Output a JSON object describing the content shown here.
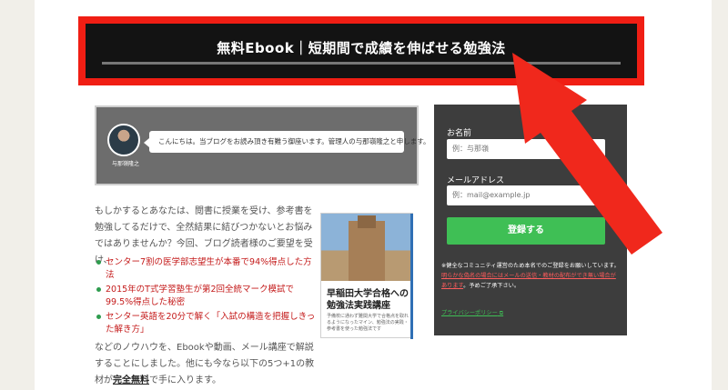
{
  "banner": {
    "title": "無料Ebook｜短期間で成績を伸ばせる勉強法"
  },
  "greeting": {
    "avatar_name": "与那嶺隆之",
    "message": "こんにちは。当ブログをお読み頂き有難う御座います。管理人の与那嶺隆之と申します。"
  },
  "intro": {
    "text": "もしかするとあなたは、閲書に授業を受け、参考書を勉強してるだけで、全然結果に結びつかないとお悩みではありませんか？今回、ブログ読者様のご要望を受け、"
  },
  "bullets": [
    "センター7割の医学部志望生が本番で94%得点した方法",
    "2015年のT式学習塾生が第2回全統マーク模試で99.5%得点した秘密",
    "センター英語を20分で解く「入試の構造を把握しきった解き方」"
  ],
  "outro": {
    "text_before": "などのノウハウを、Ebookや動画、メール講座で解説することにしました。他にも今なら以下の5つ+1の教材が",
    "emphasis": "完全無料",
    "text_after": "で手に入ります。"
  },
  "ebook": {
    "title": "早稲田大学合格への勉強法実践講座",
    "subtitle": "予備校に通わず難関大学で合格点を取れるようになったマイン、勉強法の実践・参考書を使った勉強法です"
  },
  "form": {
    "name_label": "お名前",
    "name_placeholder": "例：与那嶺",
    "email_label": "メールアドレス",
    "email_placeholder": "例：mail@example.jp",
    "submit_label": "登録する",
    "note_prefix": "※健全なコミュニティ運営のため本名でのご登録をお願いしています。",
    "note_red": "明らかな偽名の場合にはメールの送信・教材の配布ができ無い場合があります",
    "note_suffix": "。予めご了承下さい。",
    "privacy_link": "プライバシーポリシー"
  },
  "colors": {
    "banner_border": "#f01e14",
    "arrow": "#f0281c",
    "submit_button": "#3fbf55",
    "highlight_text": "#c41a1a"
  }
}
